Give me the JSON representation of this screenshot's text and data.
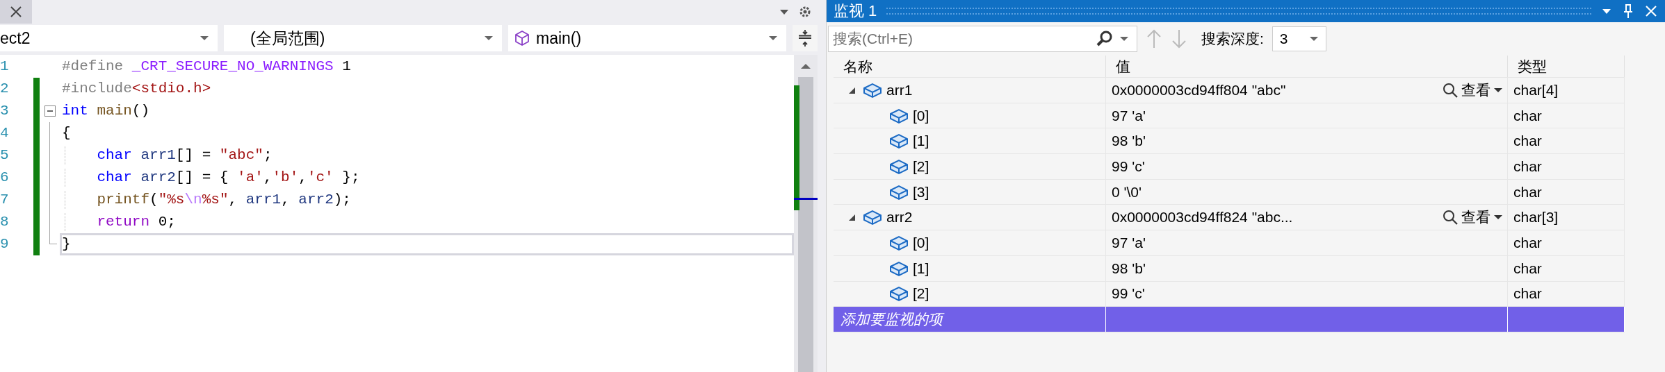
{
  "editor": {
    "nav": {
      "project": "ect2",
      "scope": "(全局范围)",
      "member": "main()"
    },
    "lines": [
      {
        "number": "1",
        "changed": false,
        "current": false,
        "tokens": [
          {
            "kind": "pre",
            "text": "#define "
          },
          {
            "kind": "macro",
            "text": "_CRT_SECURE_NO_WARNINGS"
          },
          {
            "kind": "plain",
            "text": " 1"
          }
        ]
      },
      {
        "number": "2",
        "changed": true,
        "current": false,
        "tokens": [
          {
            "kind": "pre",
            "text": "#include"
          },
          {
            "kind": "string",
            "text": "<stdio.h>"
          }
        ]
      },
      {
        "number": "3",
        "changed": true,
        "current": false,
        "fold_expanded": true,
        "tokens": [
          {
            "kind": "keyword",
            "text": "int "
          },
          {
            "kind": "function",
            "text": "main"
          },
          {
            "kind": "plain",
            "text": "()"
          }
        ]
      },
      {
        "number": "4",
        "changed": true,
        "current": false,
        "tokens": [
          {
            "kind": "plain",
            "text": "{"
          }
        ]
      },
      {
        "number": "5",
        "changed": true,
        "current": false,
        "tokens": [
          {
            "kind": "keyword",
            "text": "    char "
          },
          {
            "kind": "variable",
            "text": "arr1"
          },
          {
            "kind": "plain",
            "text": "[] = "
          },
          {
            "kind": "string",
            "text": "\"abc\""
          },
          {
            "kind": "plain",
            "text": ";"
          }
        ]
      },
      {
        "number": "6",
        "changed": true,
        "current": false,
        "tokens": [
          {
            "kind": "keyword",
            "text": "    char "
          },
          {
            "kind": "variable",
            "text": "arr2"
          },
          {
            "kind": "plain",
            "text": "[] = { "
          },
          {
            "kind": "string",
            "text": "'a'"
          },
          {
            "kind": "plain",
            "text": ","
          },
          {
            "kind": "string",
            "text": "'b'"
          },
          {
            "kind": "plain",
            "text": ","
          },
          {
            "kind": "string",
            "text": "'c'"
          },
          {
            "kind": "plain",
            "text": " };"
          }
        ]
      },
      {
        "number": "7",
        "changed": true,
        "current": false,
        "tokens": [
          {
            "kind": "function",
            "text": "    printf"
          },
          {
            "kind": "plain",
            "text": "("
          },
          {
            "kind": "string",
            "text": "\"%s"
          },
          {
            "kind": "escape",
            "text": "\\n"
          },
          {
            "kind": "string",
            "text": "%s\""
          },
          {
            "kind": "plain",
            "text": ", "
          },
          {
            "kind": "variable",
            "text": "arr1"
          },
          {
            "kind": "plain",
            "text": ", "
          },
          {
            "kind": "variable",
            "text": "arr2"
          },
          {
            "kind": "plain",
            "text": ");"
          }
        ]
      },
      {
        "number": "8",
        "changed": true,
        "current": false,
        "tokens": [
          {
            "kind": "control",
            "text": "    return"
          },
          {
            "kind": "plain",
            "text": " 0;"
          }
        ]
      },
      {
        "number": "9",
        "changed": true,
        "current": true,
        "tokens": [
          {
            "kind": "plain",
            "text": "}"
          }
        ]
      }
    ]
  },
  "watch": {
    "title": "监视 1",
    "search": {
      "placeholder": "搜索(Ctrl+E)"
    },
    "depth_label": "搜索深度:",
    "depth": "3",
    "columns": [
      "名称",
      "值",
      "类型"
    ],
    "rows": [
      {
        "name": "arr1",
        "value": "0x0000003cd94ff804 \"abc\"",
        "view_label": "查看",
        "type": "char[4]",
        "expanded": true,
        "children": [
          {
            "name": "[0]",
            "value": "97 'a'",
            "type": "char"
          },
          {
            "name": "[1]",
            "value": "98 'b'",
            "type": "char"
          },
          {
            "name": "[2]",
            "value": "99 'c'",
            "type": "char"
          },
          {
            "name": "[3]",
            "value": "0 '\\0'",
            "type": "char"
          }
        ]
      },
      {
        "name": "arr2",
        "value": "0x0000003cd94ff824 \"abc...",
        "view_label": "查看",
        "type": "char[3]",
        "expanded": true,
        "children": [
          {
            "name": "[0]",
            "value": "97 'a'",
            "type": "char"
          },
          {
            "name": "[1]",
            "value": "98 'b'",
            "type": "char"
          },
          {
            "name": "[2]",
            "value": "99 'c'",
            "type": "char"
          }
        ]
      }
    ],
    "add_row": {
      "text": "添加要监视的项",
      "selected": true
    }
  }
}
